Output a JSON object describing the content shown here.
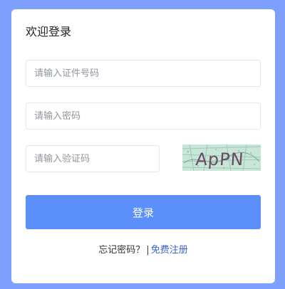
{
  "form": {
    "title": "欢迎登录",
    "id_placeholder": "请输入证件号码",
    "password_placeholder": "请输入密码",
    "captcha_placeholder": "请输入验证码",
    "captcha_text": "ApPN",
    "login_label": "登录"
  },
  "footer": {
    "forgot_label": "忘记密码？",
    "separator": "|",
    "register_label": "免费注册"
  },
  "colors": {
    "background": "#7f9ffd",
    "button": "#5b8ff9",
    "link": "#3a62c4"
  }
}
